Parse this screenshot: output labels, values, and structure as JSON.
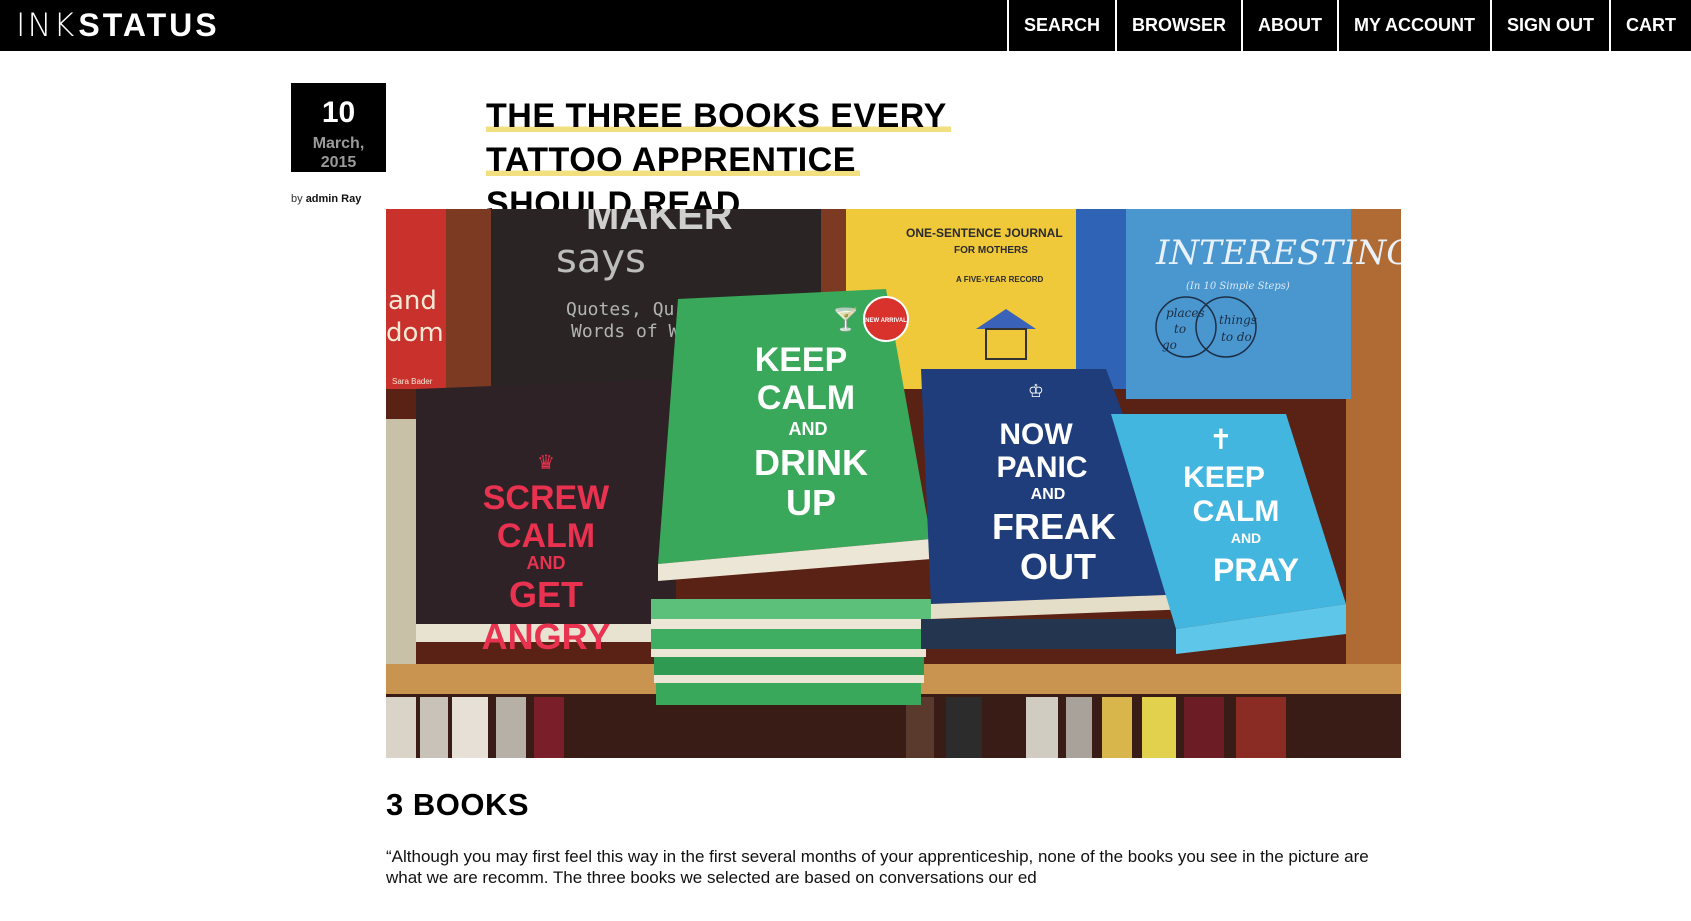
{
  "header": {
    "logo_thin": "INK",
    "logo_bold": "STATUS",
    "nav": [
      {
        "id": "search",
        "label": "SEARCH"
      },
      {
        "id": "browser",
        "label": "BROWSER"
      },
      {
        "id": "about",
        "label": "ABOUT"
      },
      {
        "id": "my-account",
        "label": "MY ACCOUNT"
      },
      {
        "id": "sign-out",
        "label": "SIGN OUT"
      },
      {
        "id": "cart",
        "label": "CART"
      }
    ]
  },
  "post": {
    "date": {
      "day": "10",
      "month": "March,",
      "year": "2015"
    },
    "byline": {
      "prefix": "by",
      "author": "admin Ray"
    },
    "title_lines": [
      "THE THREE BOOKS EVERY",
      "TATTOO APPRENTICE",
      "SHOULD READ"
    ],
    "image": {
      "books": {
        "back_left": {
          "line1": "MAKER",
          "line2": "says",
          "line3": "Quotes, Qu",
          "line4": "Words of W",
          "side1": "and",
          "side2": "dom",
          "author": "Sara Bader"
        },
        "back_middle": {
          "line1": "ONE-SENTENCE JOURNAL",
          "line2": "FOR MOTHERS",
          "line3": "A FIVE-YEAR RECORD"
        },
        "back_right": {
          "line1": "INTERESTING",
          "line2": "(In 10 Simple Steps)",
          "line3": "places",
          "line4": "to",
          "line5": "go",
          "line6": "things",
          "line7": "to do"
        },
        "red_book": [
          "SCREW",
          "CALM",
          "AND",
          "GET",
          "ANGRY"
        ],
        "green_book": [
          "KEEP",
          "CALM",
          "AND",
          "DRINK",
          "UP"
        ],
        "sticker": "NEW ARRIVAL",
        "navy_book": [
          "NOW",
          "PANIC",
          "AND",
          "FREAK",
          "OUT"
        ],
        "blue_book": [
          "KEEP",
          "CALM",
          "AND",
          "PRAY"
        ]
      }
    },
    "section_heading": "3 BOOKS",
    "excerpt": "“Although you may first feel this way in the first several months of your apprenticeship, none of the books you see in the picture are what we are recomm. The three books we selected are based on conversations our ed"
  },
  "colors": {
    "topbar": "#000000",
    "title_highlight": "#f1df80",
    "date_secondary": "#9a9a9a",
    "red_book": "#2a1e22",
    "red_text": "#e8324f",
    "green_book": "#3aa85a",
    "navy_book": "#1f3d7a",
    "blue_book": "#43b6e0"
  }
}
